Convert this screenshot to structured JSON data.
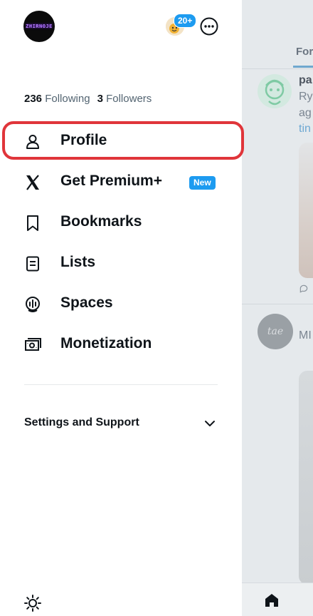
{
  "account": {
    "avatar_text": "ZHIRNOJE",
    "other_accounts_badge": "20+"
  },
  "stats": {
    "following_count": "236",
    "following_label": "Following",
    "followers_count": "3",
    "followers_label": "Followers"
  },
  "menu": {
    "items": [
      {
        "label": "Profile",
        "icon": "person-icon"
      },
      {
        "label": "Get Premium+",
        "icon": "x-logo-icon",
        "badge": "New"
      },
      {
        "label": "Bookmarks",
        "icon": "bookmark-icon"
      },
      {
        "label": "Lists",
        "icon": "list-icon"
      },
      {
        "label": "Spaces",
        "icon": "spaces-icon"
      },
      {
        "label": "Monetization",
        "icon": "monetization-icon"
      }
    ]
  },
  "settings": {
    "label": "Settings and Support"
  },
  "background_timeline": {
    "tab_label": "For",
    "post1": {
      "name_partial": "pa",
      "text_line1": "Ry",
      "text_line2": "ag",
      "link_partial": "tin"
    },
    "post2": {
      "avatar_text": "tae",
      "text_partial": "MI"
    }
  },
  "colors": {
    "accent": "#1d9bf0",
    "highlight": "#e0353a",
    "text_primary": "#0f1419",
    "text_secondary": "#536471"
  }
}
